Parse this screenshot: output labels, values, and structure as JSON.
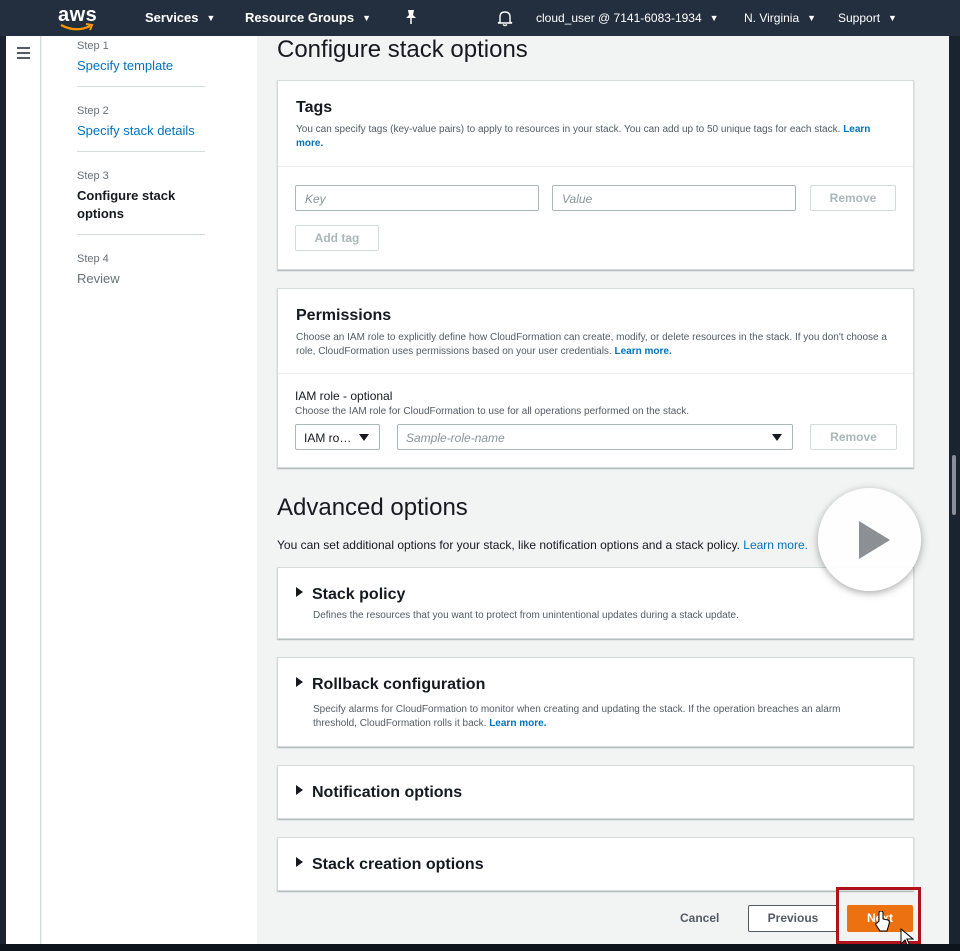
{
  "topnav": {
    "logo_text": "aws",
    "services": "Services",
    "resource_groups": "Resource Groups",
    "account": "cloud_user @ 7141-6083-1934",
    "region": "N. Virginia",
    "support": "Support"
  },
  "steps": [
    {
      "num": "Step 1",
      "title": "Specify template"
    },
    {
      "num": "Step 2",
      "title": "Specify stack details"
    },
    {
      "num": "Step 3",
      "title": "Configure stack options"
    },
    {
      "num": "Step 4",
      "title": "Review"
    }
  ],
  "page_title": "Configure stack options",
  "tags": {
    "title": "Tags",
    "desc": "You can specify tags (key-value pairs) to apply to resources in your stack. You can add up to 50 unique tags for each stack.",
    "learn_more": "Learn more.",
    "key_placeholder": "Key",
    "value_placeholder": "Value",
    "remove": "Remove",
    "add_tag": "Add tag"
  },
  "permissions": {
    "title": "Permissions",
    "desc": "Choose an IAM role to explicitly define how CloudFormation can create, modify, or delete resources in the stack. If you don't choose a role, CloudFormation uses permissions based on your user credentials.",
    "learn_more": "Learn more.",
    "iam_label": "IAM role - optional",
    "iam_hint": "Choose the IAM role for CloudFormation to use for all operations performed on the stack.",
    "iam_type": "IAM ro…",
    "role_placeholder": "Sample-role-name",
    "remove": "Remove"
  },
  "advanced": {
    "title": "Advanced options",
    "desc": "You can set additional options for your stack, like notification options and a stack policy.",
    "learn_more": "Learn more.",
    "sections": [
      {
        "title": "Stack policy",
        "desc": "Defines the resources that you want to protect from unintentional updates during a stack update."
      },
      {
        "title": "Rollback configuration",
        "desc": "Specify alarms for CloudFormation to monitor when creating and updating the stack. If the operation breaches an alarm threshold, CloudFormation rolls it back.",
        "learn_more": "Learn more."
      },
      {
        "title": "Notification options"
      },
      {
        "title": "Stack creation options"
      }
    ]
  },
  "footer": {
    "cancel": "Cancel",
    "previous": "Previous",
    "next": "Next"
  },
  "colors": {
    "nav_bg": "#232f3e",
    "link": "#0073bb",
    "primary": "#ec7211",
    "highlight": "#b0121b"
  }
}
